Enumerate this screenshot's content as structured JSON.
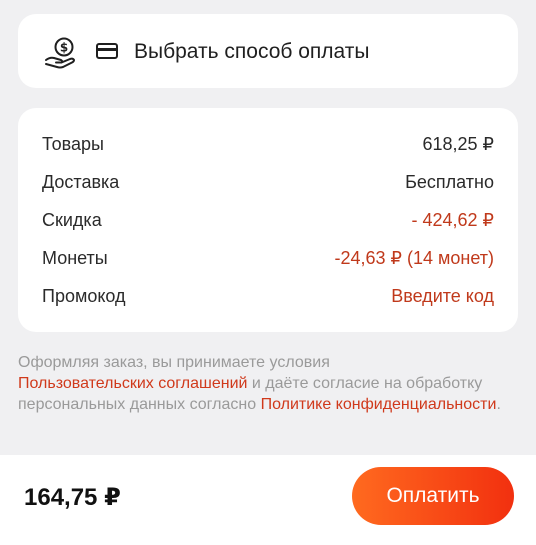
{
  "payment_method": {
    "label": "Выбрать способ оплаты",
    "icon": "coin-hand-icon",
    "card_icon": "credit-card-icon"
  },
  "summary": {
    "goods": {
      "label": "Товары",
      "value": "618,25 ₽"
    },
    "delivery": {
      "label": "Доставка",
      "value": "Бесплатно"
    },
    "discount": {
      "label": "Скидка",
      "value": "- 424,62 ₽"
    },
    "coins": {
      "label": "Монеты",
      "value": "-24,63 ₽ (14 монет)"
    },
    "promo": {
      "label": "Промокод",
      "value": "Введите код"
    }
  },
  "legal": {
    "text1": "Оформляя заказ, вы принимаете условия",
    "link_terms": "Пользовательских соглашений",
    "text2": " и даёте согласие на обработку персональных данных согласно ",
    "link_privacy": "Политике конфиденциальности",
    "text3": "."
  },
  "footer": {
    "total": "164,75 ₽",
    "pay_button": "Оплатить"
  },
  "colors": {
    "accent": "#f2300f",
    "accent_gradient_start": "#ff6a1f",
    "discount_red": "#c0391b",
    "background": "#f0f0f2"
  }
}
